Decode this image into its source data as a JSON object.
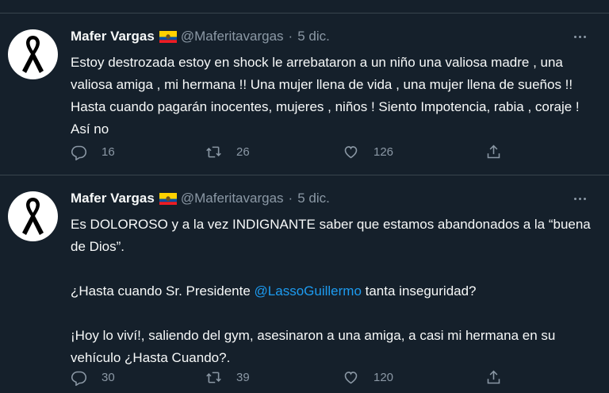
{
  "tweets": [
    {
      "author": {
        "name": "Mafer Vargas",
        "handle": "@Maferitavargas",
        "flag_icon": "ecuador-flag-icon",
        "avatar_icon": "black-ribbon-icon"
      },
      "separator": "·",
      "date": "5 dic.",
      "paragraphs": [
        "Estoy destrozada estoy en shock le arrebataron a un niño una valiosa madre , una valiosa amiga , mi hermana !! Una mujer llena de vida , una mujer llena de sueños !! Hasta cuando pagarán inocentes, mujeres , niños ! Siento Impotencia, rabia , coraje ! Así no"
      ],
      "stats": {
        "replies": "16",
        "retweets": "26",
        "likes": "126"
      }
    },
    {
      "author": {
        "name": "Mafer Vargas",
        "handle": "@Maferitavargas",
        "flag_icon": "ecuador-flag-icon",
        "avatar_icon": "black-ribbon-icon"
      },
      "separator": "·",
      "date": "5 dic.",
      "p1": "Es DOLOROSO y a la vez INDIGNANTE saber que estamos abandonados a la “buena de Dios”.",
      "p2_before": "¿Hasta cuando Sr. Presidente ",
      "p2_mention": "@LassoGuillermo",
      "p2_after": " tanta inseguridad?",
      "p3": "¡Hoy lo viví!, saliendo del gym, asesinaron a una amiga, a casi mi hermana en su vehículo ¿Hasta Cuando?.",
      "stats": {
        "replies": "30",
        "retweets": "39",
        "likes": "120"
      }
    }
  ],
  "colors": {
    "background": "#15202b",
    "text": "#f7f9f9",
    "secondary": "#8b98a5",
    "mention": "#1d9bf0",
    "divider": "#38444d"
  }
}
